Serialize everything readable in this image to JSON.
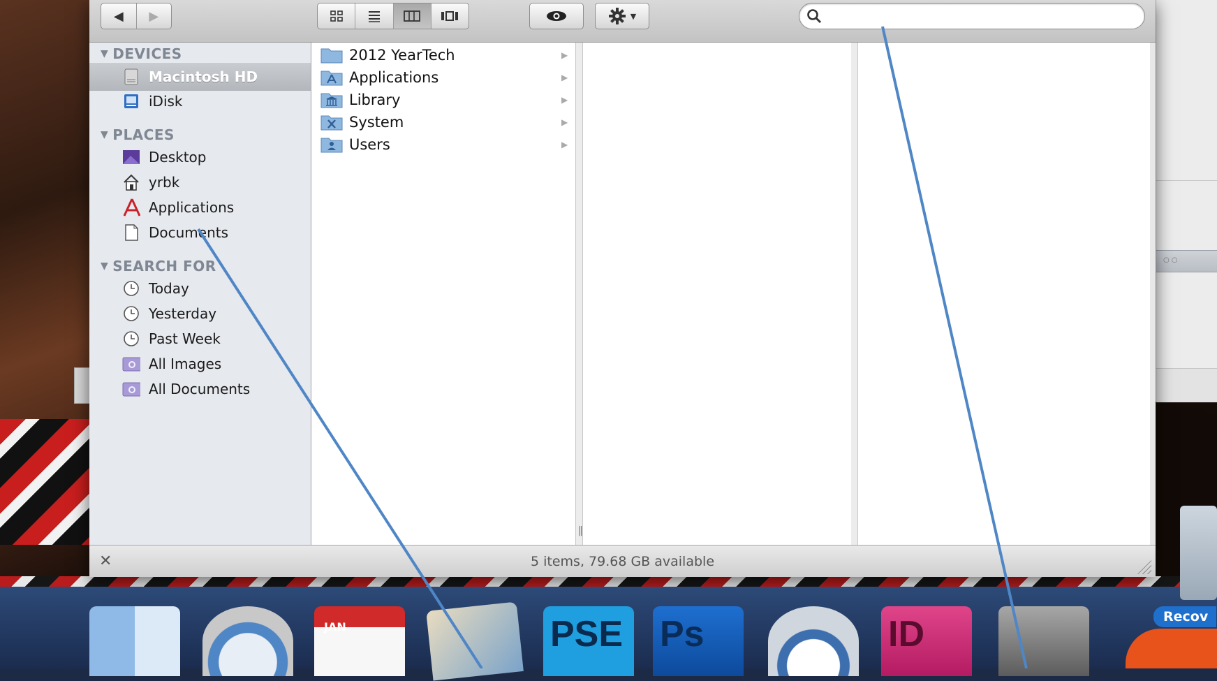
{
  "toolbar": {
    "back_icon": "◀",
    "forward_icon": "▶",
    "view_icons": [
      "icon-view",
      "list-view",
      "column-view",
      "coverflow-view"
    ],
    "active_view": "column-view",
    "search_placeholder": ""
  },
  "sidebar": {
    "sections": [
      {
        "title": "DEVICES",
        "items": [
          {
            "label": "Macintosh HD",
            "icon": "hard-drive-icon",
            "selected": true
          },
          {
            "label": "iDisk",
            "icon": "idisk-icon"
          }
        ]
      },
      {
        "title": "PLACES",
        "items": [
          {
            "label": "Desktop",
            "icon": "desktop-icon"
          },
          {
            "label": "yrbk",
            "icon": "home-icon"
          },
          {
            "label": "Applications",
            "icon": "applications-icon"
          },
          {
            "label": "Documents",
            "icon": "documents-icon"
          }
        ]
      },
      {
        "title": "SEARCH FOR",
        "items": [
          {
            "label": "Today",
            "icon": "clock-icon"
          },
          {
            "label": "Yesterday",
            "icon": "clock-icon"
          },
          {
            "label": "Past Week",
            "icon": "clock-icon"
          },
          {
            "label": "All Images",
            "icon": "smart-folder-icon"
          },
          {
            "label": "All Documents",
            "icon": "smart-folder-icon"
          }
        ]
      }
    ]
  },
  "column1": {
    "items": [
      {
        "label": "2012 YearTech",
        "icon": "folder-icon"
      },
      {
        "label": "Applications",
        "icon": "applications-folder-icon"
      },
      {
        "label": "Library",
        "icon": "library-folder-icon"
      },
      {
        "label": "System",
        "icon": "system-folder-icon"
      },
      {
        "label": "Users",
        "icon": "users-folder-icon"
      }
    ]
  },
  "status": {
    "text": "5 items, 79.68 GB available"
  },
  "dock": {
    "ical_month": "JAN",
    "pse_label": "PSE",
    "ps_label": "Ps",
    "id_label": "ID",
    "recovery_label": "Recov"
  },
  "colors": {
    "sidebar_bg": "#e6e9ee",
    "selection": "#b3b7bc",
    "annotation_line": "#4f86c6"
  }
}
